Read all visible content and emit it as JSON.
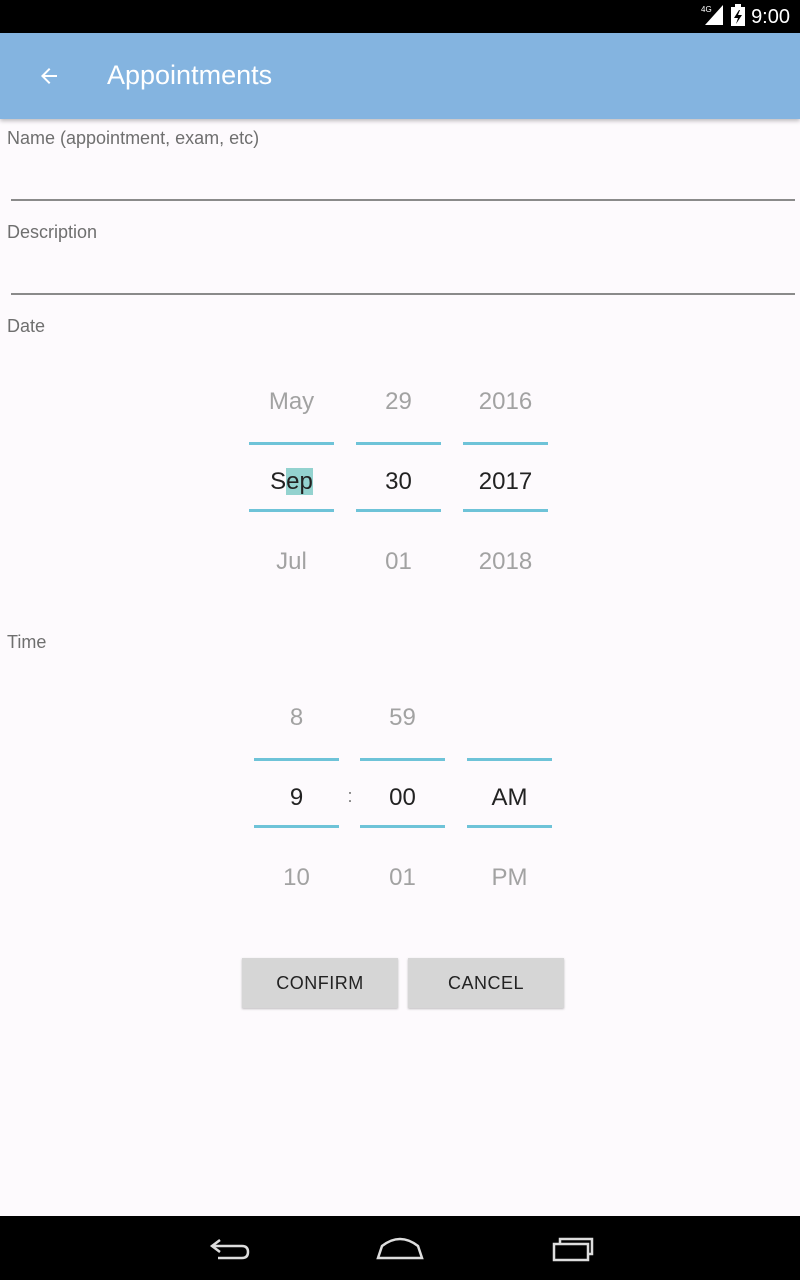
{
  "status_bar": {
    "network": "4G",
    "time": "9:00"
  },
  "app_bar": {
    "title": "Appointments",
    "back_icon": "arrow-back-icon"
  },
  "form": {
    "name_label": "Name (appointment, exam, etc)",
    "name_value": "",
    "description_label": "Description",
    "description_value": "",
    "date_label": "Date",
    "time_label": "Time"
  },
  "date_picker": {
    "month": {
      "prev": "May",
      "current_highlight_prefix": "S",
      "current_highlight": "ep",
      "next": "Jul"
    },
    "day": {
      "prev": "29",
      "current": "30",
      "next": "01"
    },
    "year": {
      "prev": "2016",
      "current": "2017",
      "next": "2018"
    }
  },
  "time_picker": {
    "hour": {
      "prev": "8",
      "current": "9",
      "next": "10"
    },
    "separator": ":",
    "minute": {
      "prev": "59",
      "current": "00",
      "next": "01"
    },
    "ampm": {
      "prev": "",
      "current": "AM",
      "next": "PM"
    }
  },
  "buttons": {
    "confirm": "CONFIRM",
    "cancel": "CANCEL"
  },
  "colors": {
    "app_bar": "#84b4e0",
    "picker_divider": "#6ec3d8",
    "selection_highlight": "#93d2cf",
    "button_bg": "#d6d6d6"
  },
  "nav_bar": {
    "icons": [
      "back-icon",
      "home-icon",
      "recents-icon"
    ]
  }
}
